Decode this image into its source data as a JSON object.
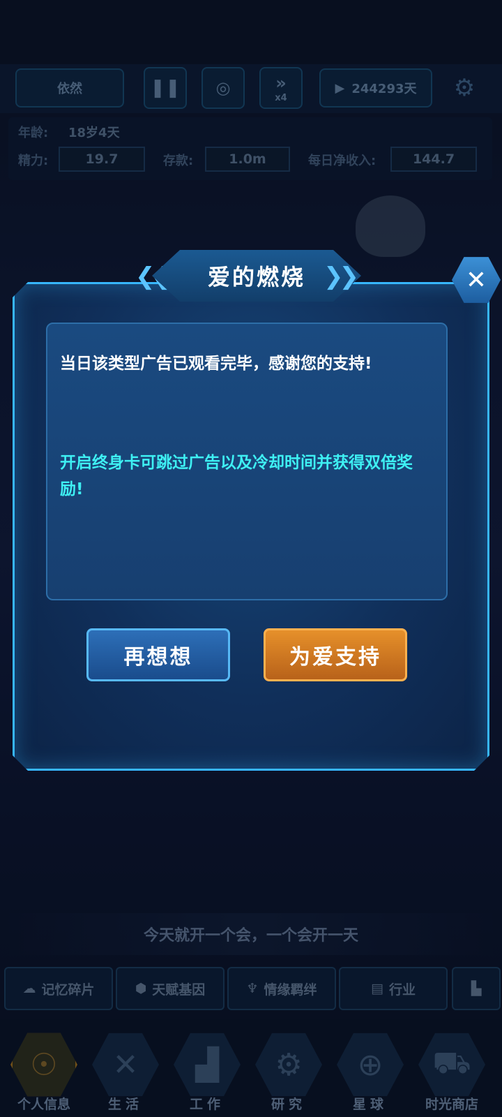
{
  "topbar": {
    "name_label": "依然",
    "speed_label": "x4",
    "days_counter": "244293天"
  },
  "stats": {
    "age_label": "年龄:",
    "age_value": "18岁4天",
    "energy_label": "精力:",
    "energy_value": "19.7",
    "savings_label": "存款:",
    "savings_value": "1.0m",
    "income_label": "每日净收入:",
    "income_value": "144.7"
  },
  "dialog": {
    "title": "爱的燃烧",
    "message_primary": "当日该类型广告已观看完毕，感谢您的支持!",
    "message_promo": "开启终身卡可跳过广告以及冷却时间并获得双倍奖励!",
    "cancel_label": "再想想",
    "support_label": "为爱支持"
  },
  "ticker": {
    "text": "今天就开一个会，一个会开一天"
  },
  "feature_tabs": [
    {
      "label": "记忆碎片",
      "icon": "brain-icon"
    },
    {
      "label": "天赋基因",
      "icon": "dna-icon"
    },
    {
      "label": "情缘羁绊",
      "icon": "mermaid-icon"
    },
    {
      "label": "行业",
      "icon": "id-card-icon"
    },
    {
      "label": "",
      "icon": "podium-icon"
    }
  ],
  "nav": [
    {
      "label": "个人信息",
      "icon": "fingerprint-icon"
    },
    {
      "label": "生活",
      "icon": "utensils-icon"
    },
    {
      "label": "工作",
      "icon": "desk-icon"
    },
    {
      "label": "研究",
      "icon": "dna-gear-icon"
    },
    {
      "label": "星球",
      "icon": "globe-icon"
    },
    {
      "label": "时光商店",
      "icon": "shop-cart-icon"
    }
  ],
  "colors": {
    "dialog_border": "#37b6ff",
    "promo_text": "#3ef0f3",
    "button_blue": "#2d6fb8",
    "button_orange": "#e6902a"
  }
}
